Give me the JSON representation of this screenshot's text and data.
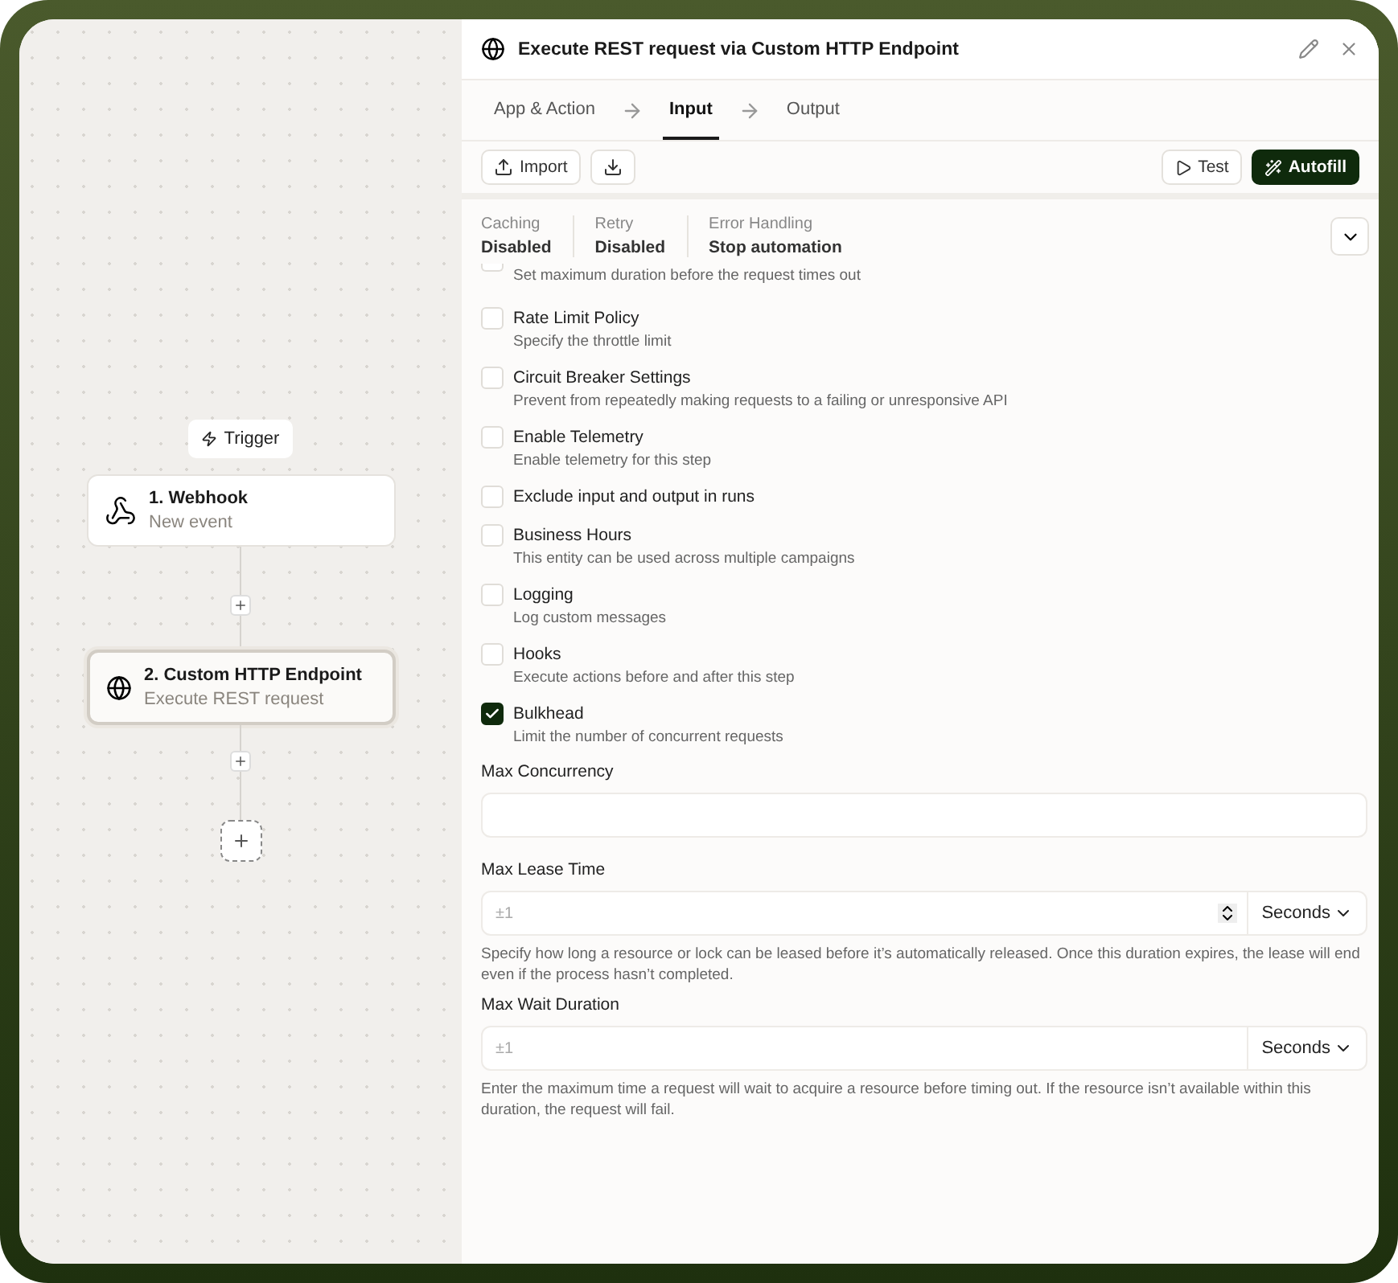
{
  "canvas": {
    "trigger_label": "Trigger",
    "steps": [
      {
        "title": "1. Webhook",
        "subtitle": "New event",
        "selected": false
      },
      {
        "title": "2. Custom HTTP Endpoint",
        "subtitle": "Execute REST request",
        "selected": true
      }
    ]
  },
  "panel": {
    "title": "Execute REST request via Custom HTTP Endpoint",
    "tabs": [
      {
        "label": "App & Action",
        "selected": false
      },
      {
        "label": "Input",
        "selected": true
      },
      {
        "label": "Output",
        "selected": false
      }
    ],
    "toolbar": {
      "import": "Import",
      "test": "Test",
      "autofill": "Autofill"
    },
    "summary": [
      {
        "label": "Caching",
        "value": "Disabled"
      },
      {
        "label": "Retry",
        "value": "Disabled"
      },
      {
        "label": "Error Handling",
        "value": "Stop automation"
      }
    ],
    "options": [
      {
        "description": "Set maximum duration before the request times out",
        "checked": false
      },
      {
        "title": "Rate Limit Policy",
        "description": "Specify the throttle limit",
        "checked": false
      },
      {
        "title": "Circuit Breaker Settings",
        "description": "Prevent from repeatedly making requests to a failing or unresponsive API",
        "checked": false
      },
      {
        "title": "Enable Telemetry",
        "description": "Enable telemetry for this step",
        "checked": false
      },
      {
        "title": "Exclude input and output in runs",
        "checked": false
      },
      {
        "title": "Business Hours",
        "description": "This entity can be used across multiple campaigns",
        "checked": false
      },
      {
        "title": "Logging",
        "description": "Log custom messages",
        "checked": false
      },
      {
        "title": "Hooks",
        "description": "Execute actions before and after this step",
        "checked": false
      },
      {
        "title": "Bulkhead",
        "description": "Limit the number of concurrent requests",
        "checked": true
      }
    ],
    "fields": [
      {
        "kind": "text",
        "label": "Max Concurrency"
      },
      {
        "kind": "duration",
        "label": "Max Lease Time",
        "placeholder": "±1",
        "stepper": true,
        "unit": "Seconds",
        "help": "Specify how long a resource or lock can be leased before it’s automatically released. Once this duration expires, the lease will end even if the process hasn’t completed."
      },
      {
        "kind": "duration",
        "label": "Max Wait Duration",
        "placeholder": "±1",
        "stepper": false,
        "unit": "Seconds",
        "help": "Enter the maximum time a request will wait to acquire a resource before timing out. If the resource isn’t available within this duration, the request will fail."
      }
    ]
  }
}
